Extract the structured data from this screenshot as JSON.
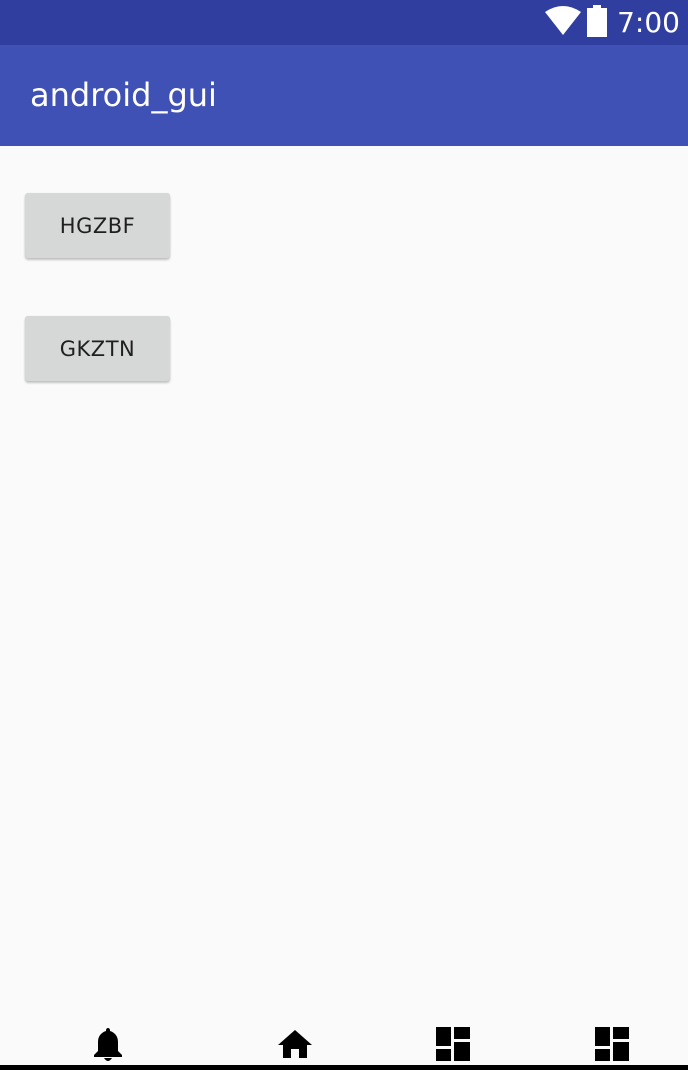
{
  "status_bar": {
    "time": "7:00",
    "icons": [
      "wifi-icon",
      "battery-icon"
    ]
  },
  "app_bar": {
    "title": "android_gui"
  },
  "buttons": [
    {
      "label": "HGZBF"
    },
    {
      "label": "GKZTN"
    }
  ],
  "nav_bar": {
    "icons": [
      "bell-icon",
      "home-icon",
      "dashboard-icon",
      "dashboard-icon"
    ]
  },
  "colors": {
    "status_bar": "#303f9f",
    "app_bar": "#3f51b5",
    "background": "#fafafa",
    "button": "#d6d7d7"
  }
}
